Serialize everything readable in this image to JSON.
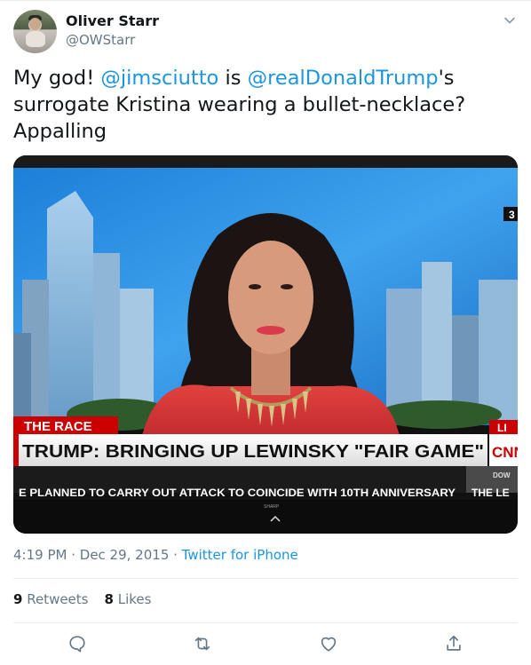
{
  "author": {
    "name": "Oliver Starr",
    "handle": "@OWStarr"
  },
  "tweet": {
    "text_1": "My god! ",
    "mention_1": "@jimsciutto",
    "text_2": " is ",
    "mention_2": "@realDonaldTrump",
    "text_3": "'s surrogate Kristina wearing a bullet-necklace? Appalling"
  },
  "media": {
    "banner_tag": "THE RACE",
    "headline": "TRUMP: BRINGING UP LEWINSKY \"FAIR GAME\"",
    "ticker": "E PLANNED TO CARRY OUT ATTACK TO COINCIDE WITH 10TH ANNIVERSARY",
    "ticker_right": "THE LE",
    "network": "CNN",
    "live_tag": "LI",
    "dow": "DOW",
    "tv_brand": "SHARP",
    "channel_digit": "3"
  },
  "meta": {
    "time": "4:19 PM",
    "sep1": " · ",
    "date": "Dec 29, 2015",
    "sep2": " · ",
    "source": "Twitter for iPhone"
  },
  "stats": {
    "retweets_count": "9",
    "retweets_label": " Retweets",
    "likes_count": "8",
    "likes_label": " Likes"
  },
  "colors": {
    "mention": "#1b95e0",
    "secondary": "#657786",
    "primary": "#14171a",
    "divider": "#e6ecf0",
    "cnn_red": "#cc0000"
  },
  "icons": [
    "chevron-down-icon",
    "reply-icon",
    "retweet-icon",
    "like-icon",
    "share-icon"
  ]
}
